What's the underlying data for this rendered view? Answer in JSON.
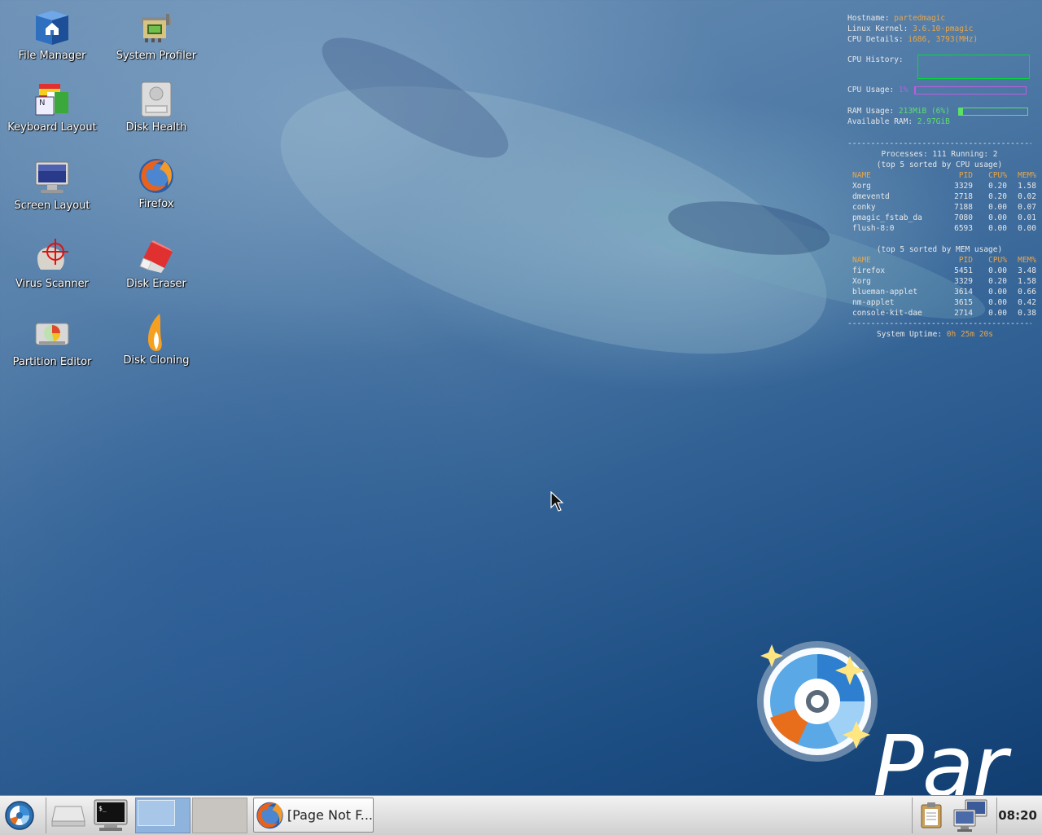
{
  "desktop": {
    "icons": [
      {
        "label": "File Manager"
      },
      {
        "label": "System Profiler"
      },
      {
        "label": "Keyboard Layout"
      },
      {
        "label": "Disk Health"
      },
      {
        "label": "Screen Layout"
      },
      {
        "label": "Firefox"
      },
      {
        "label": "Virus Scanner"
      },
      {
        "label": "Disk Eraser"
      },
      {
        "label": "Partition Editor"
      },
      {
        "label": "Disk Cloning"
      }
    ],
    "logo_text": "Par"
  },
  "conky": {
    "hostname_label": "Hostname: ",
    "hostname": "partedmagic",
    "kernel_label": "Linux Kernel: ",
    "kernel": "3.6.10-pmagic",
    "cpu_label": "CPU Details: ",
    "cpu": "i686, 3793(MHz)",
    "cpu_history_label": "CPU History:",
    "cpu_usage_label": "CPU Usage: ",
    "cpu_usage": "1%",
    "cpu_usage_fraction": 0.01,
    "ram_usage_label": "RAM Usage: ",
    "ram_usage": "213MiB (6%)",
    "ram_usage_fraction": 0.06,
    "available_ram_label": "Available RAM: ",
    "available_ram": "2.97GiB",
    "dash_line": "--------------------------------------------",
    "processes_line": "Processes: 111  Running: 2",
    "cpu_sort_title": "(top 5 sorted by CPU usage)",
    "mem_sort_title": "(top 5 sorted by MEM usage)",
    "columns": [
      "NAME",
      "PID",
      "CPU%",
      "MEM%"
    ],
    "cpu_table": [
      [
        "Xorg",
        "3329",
        "0.20",
        "1.58"
      ],
      [
        "dmeventd",
        "2718",
        "0.20",
        "0.02"
      ],
      [
        "conky",
        "7188",
        "0.00",
        "0.07"
      ],
      [
        "pmagic_fstab_da",
        "7080",
        "0.00",
        "0.01"
      ],
      [
        "flush-8:0",
        "6593",
        "0.00",
        "0.00"
      ]
    ],
    "mem_table": [
      [
        "firefox",
        "5451",
        "0.00",
        "3.48"
      ],
      [
        "Xorg",
        "3329",
        "0.20",
        "1.58"
      ],
      [
        "blueman-applet",
        "3614",
        "0.00",
        "0.66"
      ],
      [
        "nm-applet",
        "3615",
        "0.00",
        "0.42"
      ],
      [
        "console-kit-dae",
        "2714",
        "0.00",
        "0.38"
      ]
    ],
    "uptime_label": "System Uptime: ",
    "uptime": "0h 25m 20s",
    "colors": {
      "label": "#e8e8e8",
      "value": "#e8a64a",
      "ram": "#5be06a",
      "cpu": "#c25be0"
    }
  },
  "taskbar": {
    "task_label": "[Page Not F...",
    "clock": "08:20"
  }
}
